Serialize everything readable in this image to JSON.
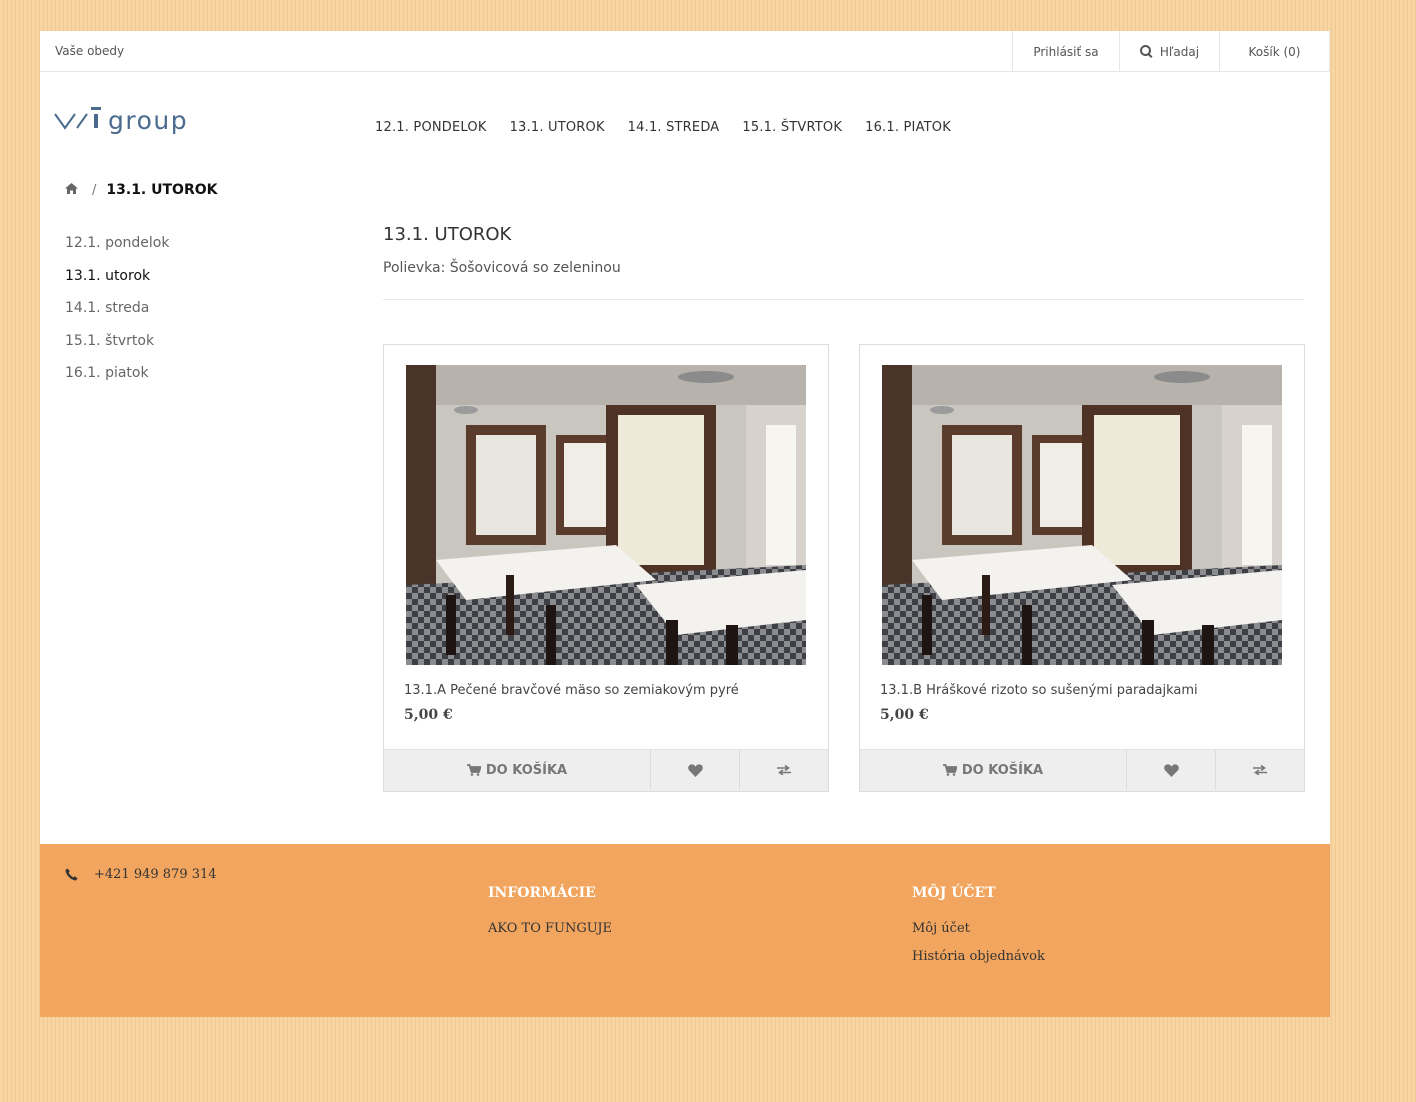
{
  "topbar": {
    "tagline": "Vaše obedy",
    "login": "Prihlásiť sa",
    "search": "Hľadaj",
    "cart": "Košík (0)"
  },
  "brand": {
    "logo_text": "vigroup",
    "logo_color": "#4b6b8e"
  },
  "mainnav": [
    "12.1. PONDELOK",
    "13.1. UTOROK",
    "14.1. STREDA",
    "15.1. ŠTVRTOK",
    "16.1. PIATOK"
  ],
  "breadcrumb": {
    "home_icon": "home-icon",
    "separator": "/",
    "current": "13.1. UTOROK"
  },
  "sidemenu": {
    "items": [
      "12.1. pondelok",
      "13.1. utorok",
      "14.1. streda",
      "15.1. štvrtok",
      "16.1. piatok"
    ],
    "active_index": 1
  },
  "category": {
    "title": "13.1. UTOROK",
    "description": "Polievka: Šošovicová so zeleninou"
  },
  "products": [
    {
      "name": "13.1.A Pečené bravčové mäso so zemiakovým pyré",
      "price": "5,00 €",
      "add_to_cart": "DO KOŠÍKA"
    },
    {
      "name": "13.1.B Hráškové rizoto so sušenými paradajkami",
      "price": "5,00 €",
      "add_to_cart": "DO KOŠÍKA"
    }
  ],
  "footer": {
    "phone": "+421 949 879 314",
    "info_heading": "INFORMÁCIE",
    "info_links": [
      "AKO TO FUNGUJE"
    ],
    "account_heading": "MÔJ ÚČET",
    "account_links": [
      "Môj účet",
      "História objednávok"
    ],
    "background_color": "#f2a55f"
  }
}
